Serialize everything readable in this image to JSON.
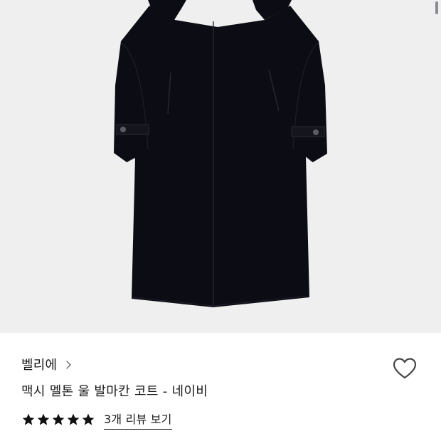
{
  "product": {
    "brand": "벨리에",
    "title": "맥시 멜톤 울 발마칸 코트 - 네이비",
    "rating": 5,
    "rating_max": 5,
    "reviews_label": "3개 리뷰 보기",
    "image_background": "#efeff0",
    "coat_color": "#0c0d14"
  },
  "icons": {
    "brand_arrow": "chevron-right-icon",
    "wishlist": "heart-outline-icon",
    "star": "star-filled-icon"
  }
}
